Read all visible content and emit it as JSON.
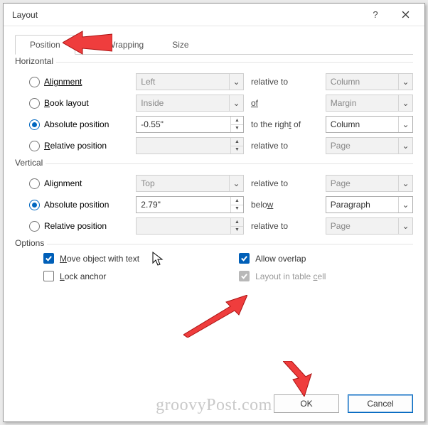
{
  "window": {
    "title": "Layout",
    "help_tip": "?",
    "close": "×"
  },
  "tabs": {
    "position": "Position",
    "textwrap": "Text Wrapping",
    "size": "Size"
  },
  "horizontal": {
    "legend": "Horizontal",
    "alignment": {
      "label": "Alignment",
      "value": "Left",
      "rel_label": "relative to",
      "rel_value": "Column"
    },
    "booklayout": {
      "label_pre": "B",
      "label_post": "ook layout",
      "value": "Inside",
      "of_label": "of",
      "of_value": "Margin"
    },
    "absolute": {
      "label": "Absolute position",
      "value": "-0.55\"",
      "right_label_pre": "to the righ",
      "right_label_mid": "t",
      "right_label_post": " of",
      "right_value": "Column"
    },
    "relative": {
      "label_pre": "R",
      "label_post": "elative position",
      "value": "",
      "rel_label": "relative to",
      "rel_value": "Page"
    }
  },
  "vertical": {
    "legend": "Vertical",
    "alignment": {
      "label": "Alignment",
      "value": "Top",
      "rel_label": "relative to",
      "rel_value": "Page"
    },
    "absolute": {
      "label": "Absolute position",
      "value": "2.79\"",
      "below_label_pre": "belo",
      "below_label_u": "w",
      "below_value": "Paragraph"
    },
    "relative": {
      "label": "Relative position",
      "value": "",
      "rel_label": "relative to",
      "rel_value": "Page"
    }
  },
  "options": {
    "legend": "Options",
    "move_pre": "M",
    "move_post": "ove object with text",
    "lock_pre": "L",
    "lock_post": "ock anchor",
    "overlap": "Allow overlap",
    "tablecell_pre": "Layout in table ",
    "tablecell_u": "c",
    "tablecell_post": "ell"
  },
  "buttons": {
    "ok": "OK",
    "cancel": "Cancel"
  },
  "watermark": "groovyPost.com"
}
